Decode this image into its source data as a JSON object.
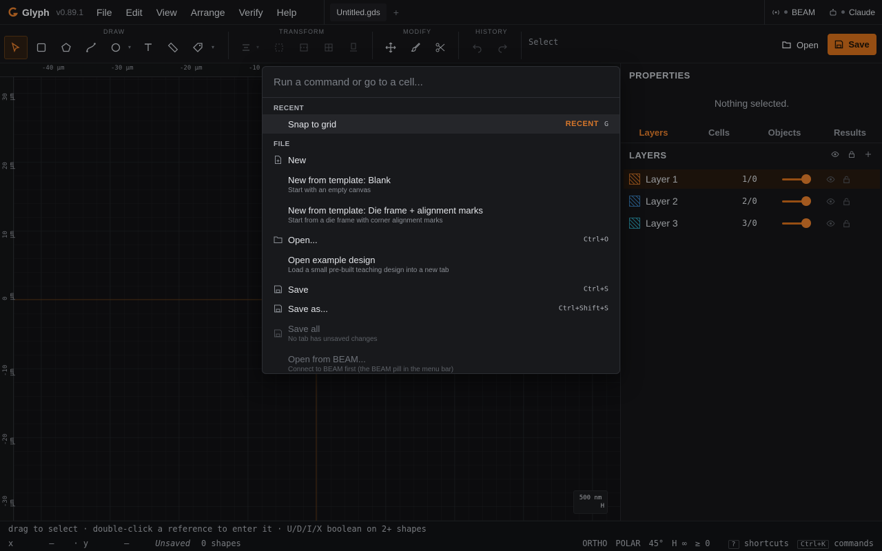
{
  "app": {
    "name": "Glyph",
    "version": "v0.89.1"
  },
  "menu": [
    "File",
    "Edit",
    "View",
    "Arrange",
    "Verify",
    "Help"
  ],
  "tab": {
    "title": "Untitled.gds"
  },
  "pills": {
    "beam": "BEAM",
    "claude": "Claude"
  },
  "toolbar": {
    "groups": {
      "draw": "DRAW",
      "transform": "TRANSFORM",
      "modify": "MODIFY",
      "history": "HISTORY"
    },
    "select_label": "Select",
    "open_label": "Open",
    "save_label": "Save"
  },
  "canvas": {
    "x_ticks": [
      "-40 µm",
      "-30 µm",
      "-20 µm",
      "-10"
    ],
    "y_ticks": [
      "30 µm",
      "20 µm",
      "10 µm",
      "0 µm",
      "-10 µm",
      "-20 µm",
      "-30 µm"
    ],
    "scale": {
      "value": "500 nm",
      "mode": "H"
    }
  },
  "panel": {
    "properties_title": "PROPERTIES",
    "nothing_selected": "Nothing selected.",
    "tabs": [
      "Layers",
      "Cells",
      "Objects",
      "Results"
    ],
    "layers_title": "LAYERS",
    "layers": [
      {
        "name": "Layer 1",
        "num": "1/0",
        "color": "#d8772a",
        "opacity": 1.0
      },
      {
        "name": "Layer 2",
        "num": "2/0",
        "color": "#3a86c8",
        "opacity": 1.0
      },
      {
        "name": "Layer 3",
        "num": "3/0",
        "color": "#2fa8c0",
        "opacity": 1.0
      }
    ]
  },
  "status": {
    "hint": "drag to select · double-click a reference to enter it · U/D/I/X boolean on 2+ shapes",
    "x_label": "x",
    "x_val": "—",
    "y_label": "· y",
    "y_val": "—",
    "unsaved": "Unsaved",
    "shapes": "0 shapes",
    "ortho": "ORTHO",
    "polar": "POLAR",
    "angle": "45°",
    "h": "H ∞",
    "ge": "≥ 0",
    "shortcuts_key": "?",
    "shortcuts": "shortcuts",
    "commands_key": "Ctrl+K",
    "commands": "commands"
  },
  "palette": {
    "placeholder": "Run a command or go to a cell...",
    "recent_label": "RECENT",
    "recent": {
      "title": "Snap to grid",
      "badge": "RECENT",
      "key": "G"
    },
    "file_label": "FILE",
    "items": [
      {
        "title": "New",
        "sub": "",
        "shortcut": "",
        "icon": "file-plus-icon",
        "disabled": false
      },
      {
        "title": "New from template: Blank",
        "sub": "Start with an empty canvas",
        "shortcut": "",
        "icon": "",
        "disabled": false
      },
      {
        "title": "New from template: Die frame + alignment marks",
        "sub": "Start from a die frame with corner alignment marks",
        "shortcut": "",
        "icon": "",
        "disabled": false
      },
      {
        "title": "Open...",
        "sub": "",
        "shortcut": "Ctrl+O",
        "icon": "folder-icon",
        "disabled": false
      },
      {
        "title": "Open example design",
        "sub": "Load a small pre-built teaching design into a new tab",
        "shortcut": "",
        "icon": "",
        "disabled": false
      },
      {
        "title": "Save",
        "sub": "",
        "shortcut": "Ctrl+S",
        "icon": "floppy-icon",
        "disabled": false
      },
      {
        "title": "Save as...",
        "sub": "",
        "shortcut": "Ctrl+Shift+S",
        "icon": "floppy-icon",
        "disabled": false
      },
      {
        "title": "Save all",
        "sub": "No tab has unsaved changes",
        "shortcut": "",
        "icon": "floppy-icon",
        "disabled": true
      },
      {
        "title": "Open from BEAM...",
        "sub": "Connect to BEAM first (the BEAM pill in the menu bar)",
        "shortcut": "",
        "icon": "",
        "disabled": true
      }
    ]
  }
}
